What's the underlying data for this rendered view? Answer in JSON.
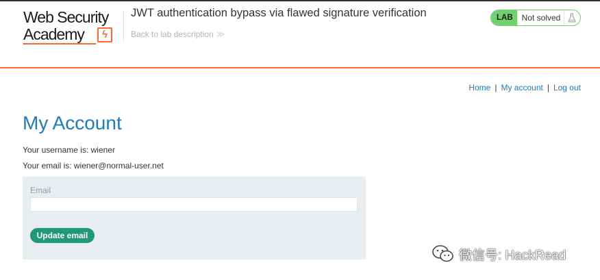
{
  "header": {
    "logo": {
      "line1": "Web Security",
      "line2": "Academy",
      "bolt": "ϟ"
    },
    "lab_title": "JWT authentication bypass via flawed signature verification",
    "back_link": "Back to lab description",
    "back_chevron": "≫",
    "status": {
      "badge": "LAB",
      "text": "Not solved",
      "icon": "flask-icon"
    }
  },
  "nav": {
    "items": [
      "Home",
      "My account",
      "Log out"
    ],
    "separator": "|"
  },
  "main": {
    "title": "My Account",
    "username_line": "Your username is: wiener",
    "email_line": "Your email is: wiener@normal-user.net",
    "form": {
      "email_label": "Email",
      "email_value": "",
      "submit_label": "Update email"
    }
  },
  "watermark": {
    "text": "微信号: HackRead",
    "icon": "wechat-icon"
  },
  "colors": {
    "accent_blue": "#1c7cbf",
    "brand_orange": "#ff6633",
    "status_green": "#70d16d",
    "button_green": "#1f9a75",
    "form_background": "#e8eef0"
  }
}
